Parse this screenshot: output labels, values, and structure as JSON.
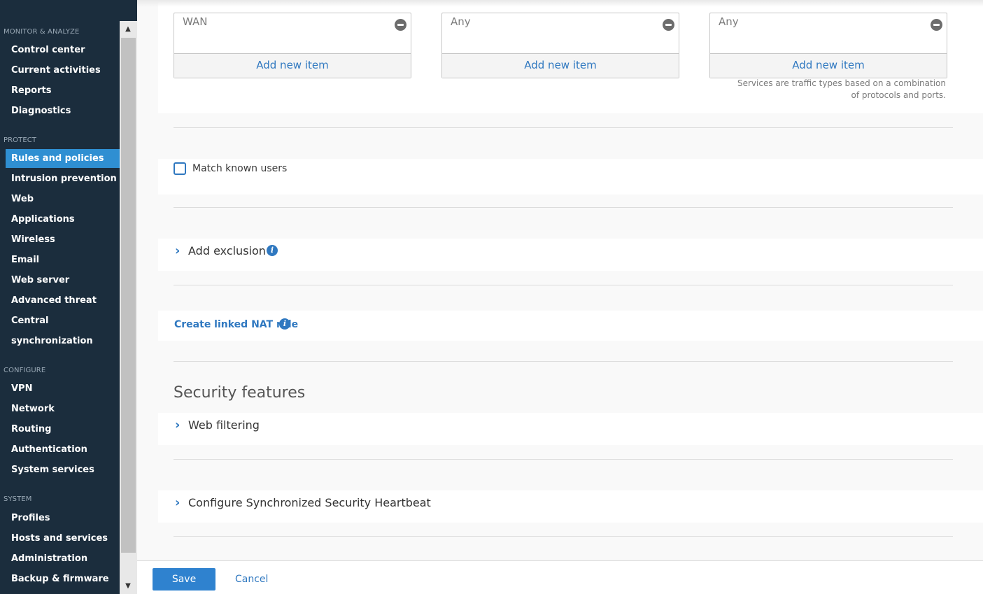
{
  "sidebar": {
    "sections": [
      {
        "label": "MONITOR & ANALYZE",
        "items": [
          "Control center",
          "Current activities",
          "Reports",
          "Diagnostics"
        ]
      },
      {
        "label": "PROTECT",
        "items": [
          "Rules and policies",
          "Intrusion prevention",
          "Web",
          "Applications",
          "Wireless",
          "Email",
          "Web server",
          "Advanced threat",
          "Central",
          "synchronization"
        ]
      },
      {
        "label": "CONFIGURE",
        "items": [
          "VPN",
          "Network",
          "Routing",
          "Authentication",
          "System services"
        ]
      },
      {
        "label": "SYSTEM",
        "items": [
          "Profiles",
          "Hosts and services",
          "Administration",
          "Backup & firmware"
        ]
      }
    ],
    "active_item": "Rules and policies"
  },
  "pickers": [
    {
      "value": "WAN",
      "add_label": "Add new item"
    },
    {
      "value": "Any",
      "add_label": "Add new item"
    },
    {
      "value": "Any",
      "add_label": "Add new item"
    }
  ],
  "services_hint": "Services are traffic types based on a combination of protocols and ports.",
  "match_known_users": {
    "label": "Match known users",
    "checked": false
  },
  "add_exclusion": {
    "label": "Add exclusion"
  },
  "linked_nat": {
    "label": "Create linked NAT rule"
  },
  "security_features": {
    "heading": "Security features",
    "web_filtering": "Web filtering",
    "heartbeat": "Configure Synchronized Security Heartbeat"
  },
  "footer": {
    "save_label": "Save",
    "cancel_label": "Cancel"
  },
  "colors": {
    "sidebar_bg": "#1b2d3d",
    "accent": "#2f8fd2",
    "link": "#2f78c0"
  }
}
